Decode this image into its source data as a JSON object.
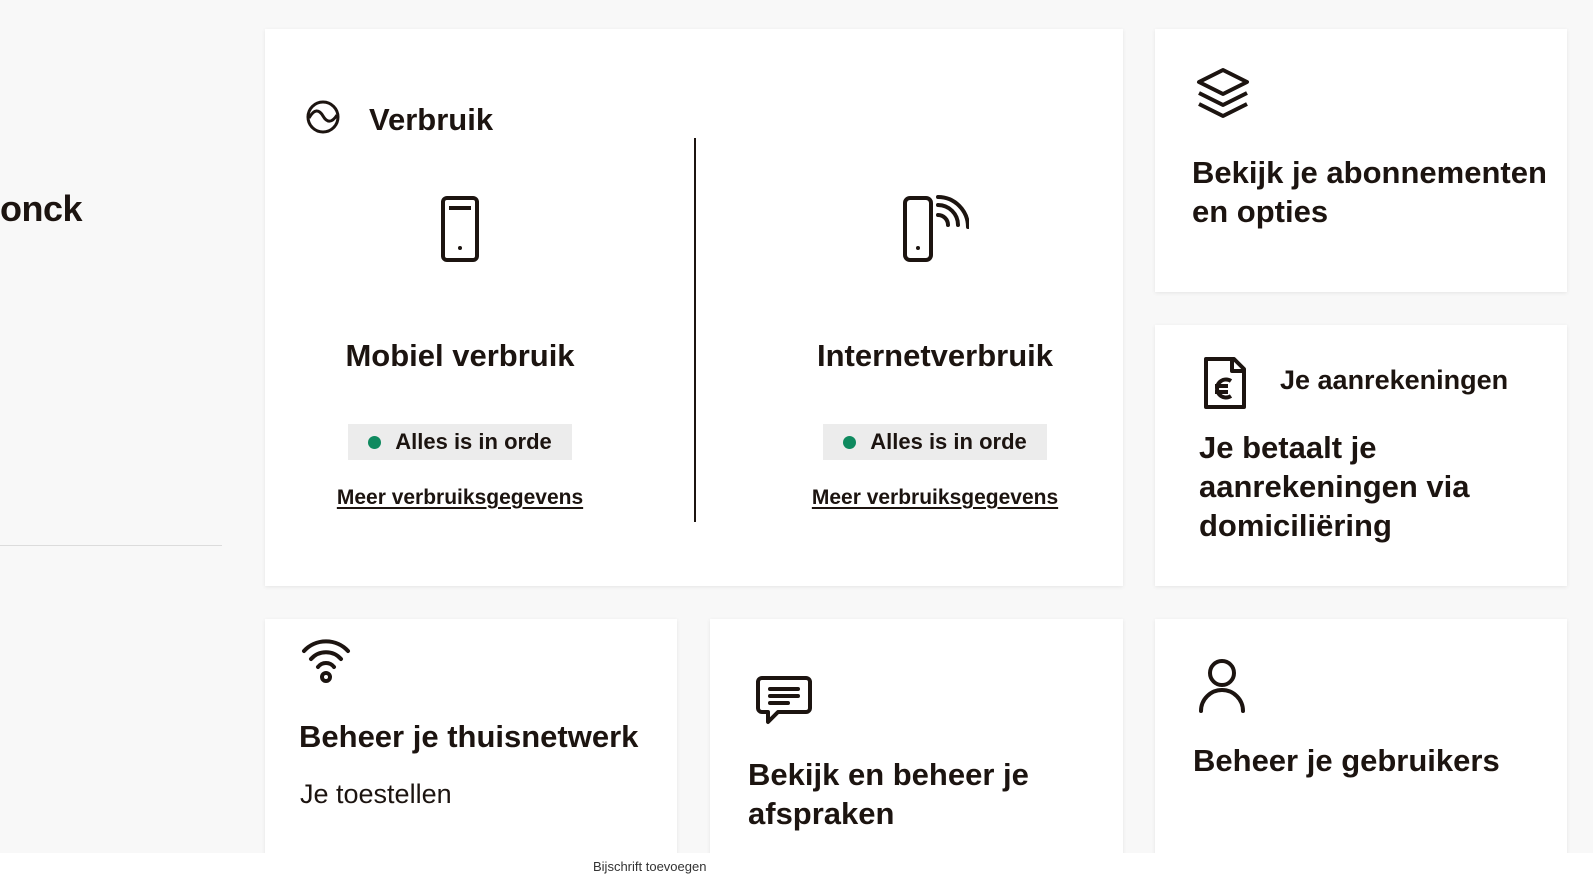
{
  "left": {
    "name_fragment": "onck"
  },
  "verbruik": {
    "title": "Verbruik",
    "mobile": {
      "title": "Mobiel verbruik",
      "status": "Alles is in orde",
      "link": "Meer verbruiksgegevens"
    },
    "internet": {
      "title": "Internetverbruik",
      "status": "Alles is in orde",
      "link": "Meer verbruiksgegevens"
    }
  },
  "abonnementen": {
    "title": "Bekijk je abonnementen en opties"
  },
  "aanrekeningen": {
    "title": "Je aanrekeningen",
    "description": "Je betaalt je aanrekeningen via domiciliëring"
  },
  "thuisnetwerk": {
    "title": "Beheer je thuisnetwerk",
    "subtitle": "Je toestellen"
  },
  "afspraken": {
    "title": "Bekijk en beheer je afspraken"
  },
  "gebruikers": {
    "title": "Beheer je gebruikers"
  },
  "caption": "Bijschrift toevoegen",
  "colors": {
    "status_ok": "#0f8a5f",
    "text": "#1c1410",
    "badge_bg": "#ececec",
    "page_bg": "#f8f8f8"
  },
  "icons": [
    "usage-gauge-icon",
    "smartphone-icon",
    "modem-wifi-icon",
    "layers-icon",
    "euro-invoice-icon",
    "wifi-icon",
    "chat-icon",
    "user-icon"
  ]
}
